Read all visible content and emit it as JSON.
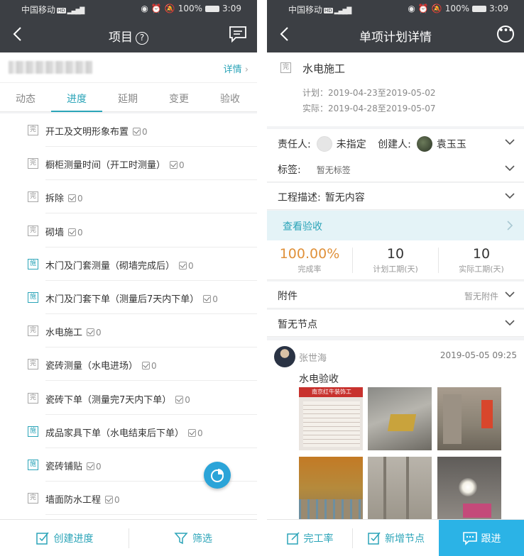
{
  "status_bar": {
    "carrier": "中国移动",
    "hd": "HD",
    "battery": "100%",
    "time": "3:09"
  },
  "left": {
    "title": "项目",
    "help_icon": "question-circle-icon",
    "detail_link": "详情",
    "tabs": [
      "动态",
      "进度",
      "延期",
      "变更",
      "验收"
    ],
    "active_tab": "进度",
    "tasks": [
      {
        "badge": "完",
        "name": "开工及文明形象布置",
        "count": "0"
      },
      {
        "badge": "完",
        "name": "橱柜测量时间（开工时测量）",
        "count": "0"
      },
      {
        "badge": "完",
        "name": "拆除",
        "count": "0"
      },
      {
        "badge": "完",
        "name": "砌墙",
        "count": "0"
      },
      {
        "badge": "施",
        "name": "木门及门套测量（砌墙完成后）",
        "count": "0"
      },
      {
        "badge": "施",
        "name": "木门及门套下单（测量后7天内下单）",
        "count": "0"
      },
      {
        "badge": "完",
        "name": "水电施工",
        "count": "0"
      },
      {
        "badge": "完",
        "name": "瓷砖测量（水电进场）",
        "count": "0"
      },
      {
        "badge": "完",
        "name": "瓷砖下单（测量完7天内下单）",
        "count": "0"
      },
      {
        "badge": "施",
        "name": "成品家具下单（水电结束后下单）",
        "count": "0"
      },
      {
        "badge": "施",
        "name": "瓷砖铺贴",
        "count": "0"
      },
      {
        "badge": "完",
        "name": "墙面防水工程",
        "count": "0"
      }
    ],
    "bottom": {
      "create": "创建进度",
      "filter": "筛选"
    }
  },
  "right": {
    "title": "单项计划详情",
    "task_badge": "完",
    "task_name": "水电施工",
    "plan_label": "计划：",
    "plan_value": "2019-04-23至2019-05-02",
    "actual_label": "实际：",
    "actual_value": "2019-04-28至2019-05-07",
    "owner_label": "责任人:",
    "owner_value": "未指定",
    "creator_label": "创建人:",
    "creator_value": "袁玉玉",
    "tag_label": "标签:",
    "tag_value": "暂无标签",
    "desc_label": "工程描述:",
    "desc_value": "暂无内容",
    "check_link": "查看验收",
    "stats": [
      {
        "value": "100.00%",
        "label": "完成率"
      },
      {
        "value": "10",
        "label": "计划工期(天)"
      },
      {
        "value": "10",
        "label": "实际工期(天)"
      }
    ],
    "attachment_label": "附件",
    "attachment_value": "暂无附件",
    "nodes_label": "暂无节点",
    "comment": {
      "author": "张世海",
      "time": "2019-05-05 09:25",
      "text": "水电验收",
      "photo_sign_text": "南京红牛装饰工"
    },
    "bottom": {
      "rate": "完工率",
      "add_node": "新增节点",
      "follow": "跟进"
    }
  },
  "colors": {
    "accent": "#2ba4b8",
    "nav": "#3c3f44",
    "orange": "#e0913a",
    "follow_btn": "#2bb3e6"
  }
}
